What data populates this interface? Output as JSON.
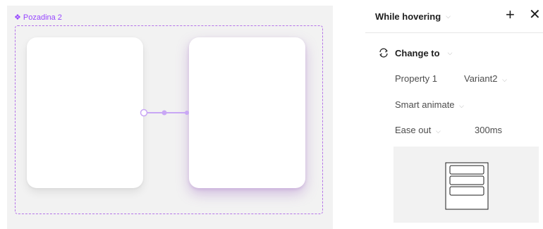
{
  "canvas": {
    "frame_label": "Pozadina 2",
    "frame_icon": "component-icon",
    "frame_color": "#9747ff"
  },
  "panel": {
    "trigger": "While hovering",
    "action": "Change to",
    "property": {
      "name": "Property 1",
      "value": "Variant2"
    },
    "animation": "Smart animate",
    "easing": "Ease out",
    "duration": "300ms"
  }
}
